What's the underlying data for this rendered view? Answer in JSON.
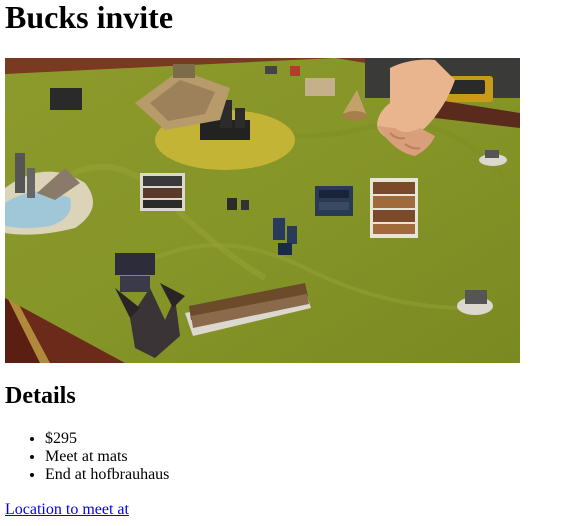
{
  "page": {
    "title": "Bucks invite"
  },
  "photo": {
    "alt": "Miniature wargame battle on a green felt table"
  },
  "details": {
    "heading": "Details",
    "items": [
      "$295",
      "Meet at mats",
      "End at hofbrauhaus"
    ]
  },
  "location_link": {
    "label": "Location to meet at"
  }
}
